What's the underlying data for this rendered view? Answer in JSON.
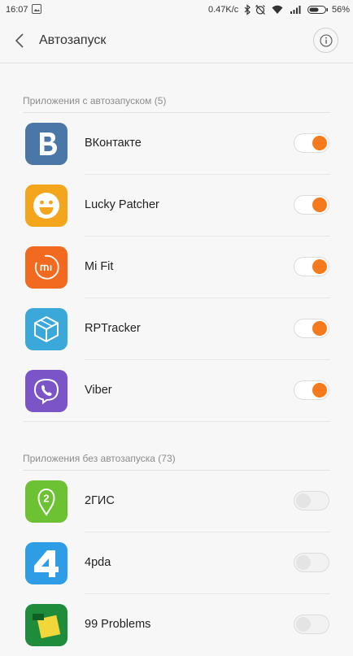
{
  "status_bar": {
    "time": "16:07",
    "net_speed": "0.47K/c",
    "battery": "56%",
    "icons": [
      "image-notification-icon",
      "bluetooth-icon",
      "alarm-off-icon",
      "wifi-icon",
      "signal-icon",
      "battery-icon"
    ]
  },
  "header": {
    "title": "Автозапуск",
    "back_icon": "chevron-left-icon",
    "info_icon": "info-icon"
  },
  "sections": {
    "enabled": {
      "title": "Приложения с автозапуском (5)",
      "apps": [
        {
          "name": "ВКонтакте",
          "enabled": true,
          "icon": "vk-icon",
          "color": "#4a76a8"
        },
        {
          "name": "Lucky Patcher",
          "enabled": true,
          "icon": "smiley-icon",
          "color": "#f3a51b"
        },
        {
          "name": "Mi Fit",
          "enabled": true,
          "icon": "mi-fit-icon",
          "color": "#f26a1f"
        },
        {
          "name": "RPTracker",
          "enabled": true,
          "icon": "cube-icon",
          "color": "#3aa8d8"
        },
        {
          "name": "Viber",
          "enabled": true,
          "icon": "viber-icon",
          "color": "#7b55c7"
        }
      ]
    },
    "disabled": {
      "title": "Приложения без автозапуска (73)",
      "apps": [
        {
          "name": "2ГИС",
          "enabled": false,
          "icon": "2gis-icon",
          "color": "#6cc232"
        },
        {
          "name": "4pda",
          "enabled": false,
          "icon": "4pda-icon",
          "color": "#2f9de6"
        },
        {
          "name": "99 Problems",
          "enabled": false,
          "icon": "99-problems-icon",
          "color": "#1e8c3a"
        }
      ]
    }
  },
  "colors": {
    "accent": "#f47a1b",
    "background": "#f7f7f7"
  }
}
